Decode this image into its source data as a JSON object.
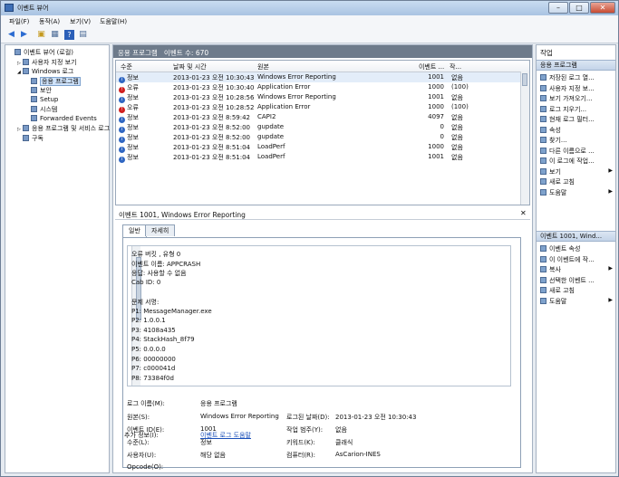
{
  "window": {
    "title": "이벤트 뷰어",
    "btn_min": "–",
    "btn_max": "□",
    "btn_close": "✕"
  },
  "menu": [
    {
      "label": "파일(F)"
    },
    {
      "label": "동작(A)"
    },
    {
      "label": "보기(V)"
    },
    {
      "label": "도움말(H)"
    }
  ],
  "toolbar": {
    "back": "◀",
    "forward": "▶",
    "folder": "▣",
    "props": "▦",
    "help": "?",
    "pane": "▤"
  },
  "tree": [
    {
      "label": "이벤트 뷰어 (로컬)",
      "indent": 0,
      "expander": ""
    },
    {
      "label": "사용자 지정 보기",
      "indent": 1,
      "expander": "▷"
    },
    {
      "label": "Windows 로그",
      "indent": 1,
      "expander": "◢"
    },
    {
      "label": "응용 프로그램",
      "indent": 2,
      "expander": "",
      "selected": true
    },
    {
      "label": "보안",
      "indent": 2,
      "expander": ""
    },
    {
      "label": "Setup",
      "indent": 2,
      "expander": ""
    },
    {
      "label": "시스템",
      "indent": 2,
      "expander": ""
    },
    {
      "label": "Forwarded Events",
      "indent": 2,
      "expander": ""
    },
    {
      "label": "응용 프로그램 및 서비스 로그",
      "indent": 1,
      "expander": "▷"
    },
    {
      "label": "구독",
      "indent": 1,
      "expander": ""
    }
  ],
  "center": {
    "header": "응용 프로그램   이벤트 수: 670",
    "columns": {
      "level": "수준",
      "date": "날짜 및 시간",
      "source": "원본",
      "id": "이벤트 ...",
      "task": "작..."
    },
    "rows": [
      {
        "level": "정보",
        "type": "info",
        "date": "2013-01-23 오전 10:30:43",
        "source": "Windows Error Reporting",
        "id": "1001",
        "task": "없음",
        "selected": true
      },
      {
        "level": "오류",
        "type": "error",
        "date": "2013-01-23 오전 10:30:40",
        "source": "Application Error",
        "id": "1000",
        "task": "(100)"
      },
      {
        "level": "정보",
        "type": "info",
        "date": "2013-01-23 오전 10:28:56",
        "source": "Windows Error Reporting",
        "id": "1001",
        "task": "없음"
      },
      {
        "level": "오류",
        "type": "error",
        "date": "2013-01-23 오전 10:28:52",
        "source": "Application Error",
        "id": "1000",
        "task": "(100)"
      },
      {
        "level": "정보",
        "type": "info",
        "date": "2013-01-23 오전 8:59:42",
        "source": "CAPI2",
        "id": "4097",
        "task": "없음"
      },
      {
        "level": "정보",
        "type": "info",
        "date": "2013-01-23 오전 8:52:00",
        "source": "gupdate",
        "id": "0",
        "task": "없음"
      },
      {
        "level": "정보",
        "type": "info",
        "date": "2013-01-23 오전 8:52:00",
        "source": "gupdate",
        "id": "0",
        "task": "없음"
      },
      {
        "level": "정보",
        "type": "info",
        "date": "2013-01-23 오전 8:51:04",
        "source": "LoadPerf",
        "id": "1000",
        "task": "없음"
      },
      {
        "level": "정보",
        "type": "info",
        "date": "2013-01-23 오전 8:51:04",
        "source": "LoadPerf",
        "id": "1001",
        "task": "없음"
      }
    ],
    "detail_title": "이벤트 1001, Windows Error Reporting",
    "detail_close": "✕",
    "tabs": [
      {
        "label": "일반"
      },
      {
        "label": "자세히"
      }
    ],
    "detail_lines": [
      "오류 버킷 , 유형 0",
      "이벤트 이름: APPCRASH",
      "응답: 사용할 수 없음",
      "Cab ID: 0",
      "",
      "문제 서명:",
      "P1: MessageManager.exe",
      "P2: 1.0.0.1",
      "P3: 4108a435",
      "P4: StackHash_8f79",
      "P5: 0.0.0.0",
      "P6: 00000000",
      "P7: c000041d",
      "P8: 73384f0d"
    ],
    "props": {
      "log_name_label": "로그 이름(M):",
      "log_name": "응용 프로그램",
      "source_label": "원본(S):",
      "source": "Windows Error Reporting",
      "logged_label": "로그된 날짜(D):",
      "logged": "2013-01-23 오전 10:30:43",
      "event_id_label": "이벤트 ID(E):",
      "event_id": "1001",
      "task_label": "작업 범주(Y):",
      "task": "없음",
      "level_label": "수준(L):",
      "level": "정보",
      "keywords_label": "키워드(K):",
      "keywords": "클래식",
      "user_label": "사용자(U):",
      "user": "해당 없음",
      "computer_label": "컴퓨터(R):",
      "computer": "AsCarion-INES",
      "opcode_label": "Opcode(O):",
      "more_info_label": "추가 정보(I):",
      "more_info_link": "이벤트 로그 도움말"
    }
  },
  "actions": {
    "title": "작업",
    "section1": "응용 프로그램",
    "items1": [
      {
        "label": "저장된 로그 열...",
        "arrow": ""
      },
      {
        "label": "사용자 지정 보...",
        "arrow": ""
      },
      {
        "label": "보기 가져오기...",
        "arrow": ""
      },
      {
        "label": "로그 지우기...",
        "arrow": ""
      },
      {
        "label": "현재 로그 필터...",
        "arrow": ""
      },
      {
        "label": "속성",
        "arrow": ""
      },
      {
        "label": "찾기...",
        "arrow": ""
      },
      {
        "label": "다른 이름으로 ...",
        "arrow": ""
      },
      {
        "label": "이 로그에 작업...",
        "arrow": ""
      },
      {
        "label": "보기",
        "arrow": "▶"
      },
      {
        "label": "새로 고침",
        "arrow": ""
      },
      {
        "label": "도움말",
        "arrow": "▶"
      }
    ],
    "section2": "이벤트 1001, Wind...",
    "items2": [
      {
        "label": "이벤트 속성",
        "arrow": ""
      },
      {
        "label": "이 이벤트에 작...",
        "arrow": ""
      },
      {
        "label": "복사",
        "arrow": "▶"
      },
      {
        "label": "선택한 이벤트 ...",
        "arrow": ""
      },
      {
        "label": "새로 고침",
        "arrow": ""
      },
      {
        "label": "도움말",
        "arrow": "▶"
      }
    ]
  }
}
